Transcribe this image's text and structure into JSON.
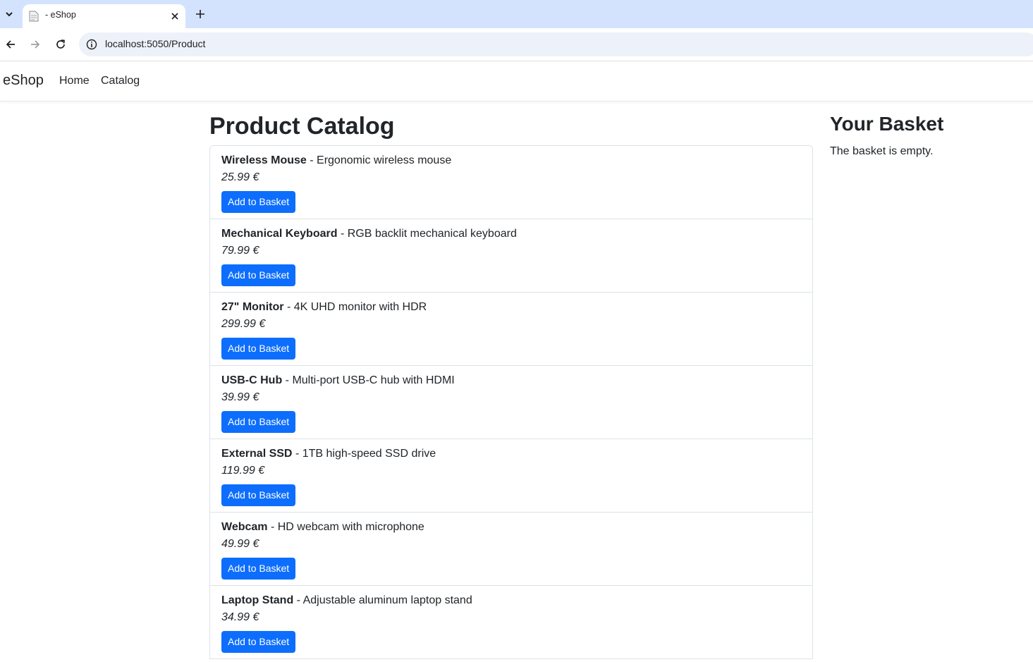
{
  "browser": {
    "tab_title": "- eShop",
    "url": "localhost:5050/Product"
  },
  "navbar": {
    "brand": "eShop",
    "links": [
      "Home",
      "Catalog"
    ]
  },
  "catalog": {
    "title": "Product Catalog",
    "add_label": "Add to Basket",
    "products": [
      {
        "name": "Wireless Mouse",
        "description": "Ergonomic wireless mouse",
        "price": "25.99 €"
      },
      {
        "name": "Mechanical Keyboard",
        "description": "RGB backlit mechanical keyboard",
        "price": "79.99 €"
      },
      {
        "name": "27\" Monitor",
        "description": "4K UHD monitor with HDR",
        "price": "299.99 €"
      },
      {
        "name": "USB-C Hub",
        "description": "Multi-port USB-C hub with HDMI",
        "price": "39.99 €"
      },
      {
        "name": "External SSD",
        "description": "1TB high-speed SSD drive",
        "price": "119.99 €"
      },
      {
        "name": "Webcam",
        "description": "HD webcam with microphone",
        "price": "49.99 €"
      },
      {
        "name": "Laptop Stand",
        "description": "Adjustable aluminum laptop stand",
        "price": "34.99 €"
      }
    ]
  },
  "basket": {
    "title": "Your Basket",
    "empty_message": "The basket is empty."
  },
  "colors": {
    "primary": "#0d6efd",
    "tabstrip": "#d3e3fd",
    "omnibox": "#edf2fa"
  }
}
